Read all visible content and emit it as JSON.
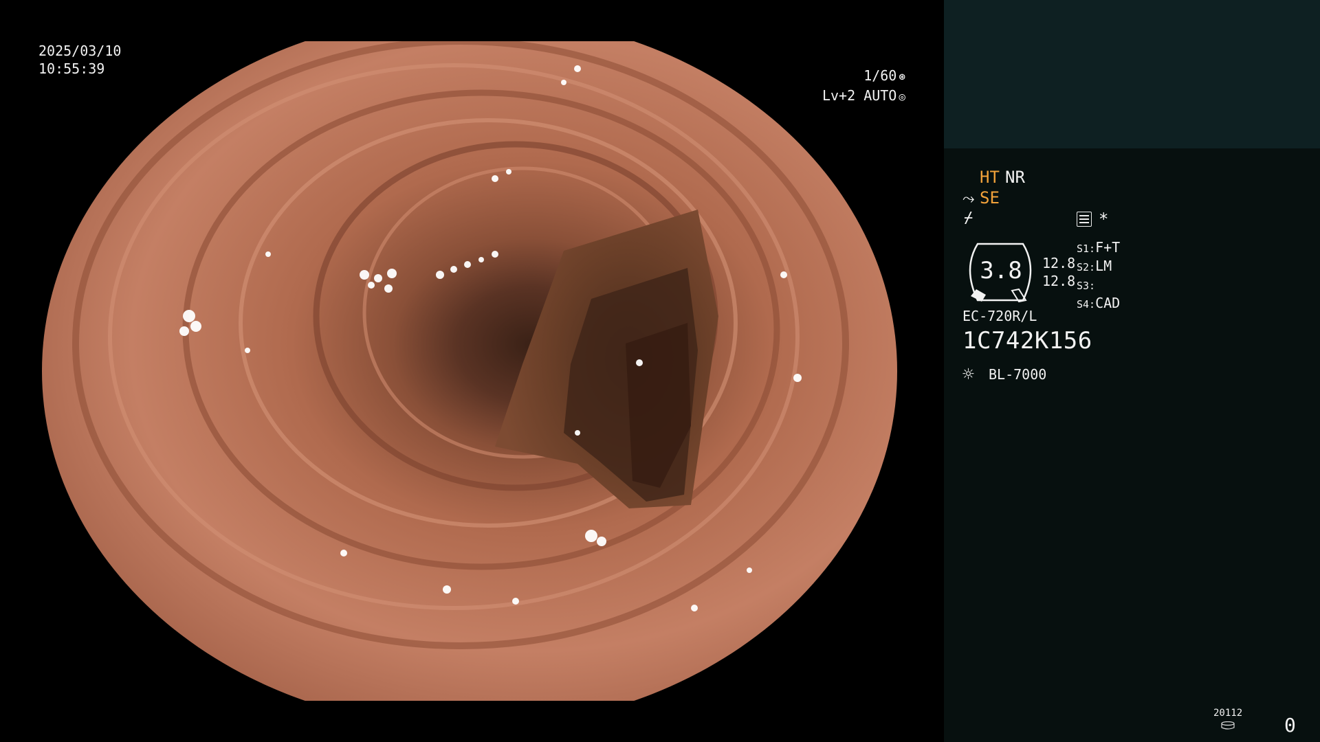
{
  "overlay": {
    "date": "2025/03/10",
    "time": "10:55:39",
    "shutter": "1/60",
    "shutter_icon": "aperture-icon",
    "level": "Lv+2",
    "mode": "AUTO",
    "mode_icon": "auto-iris-icon"
  },
  "settings": {
    "ht": "HT",
    "nr": "NR",
    "se": "SE",
    "se_icon": "scope-tip-icon",
    "freeze_icon": "freeze-icon",
    "menu_icon": "settings-list-icon",
    "star": "*"
  },
  "gauge": {
    "value": "3.8",
    "side_values": [
      "12.8",
      "12.8"
    ]
  },
  "scope_switches": [
    {
      "key": "S1:",
      "value": "F+T"
    },
    {
      "key": "S2:",
      "value": "LM"
    },
    {
      "key": "S3:",
      "value": ""
    },
    {
      "key": "S4:",
      "value": "CAD"
    }
  ],
  "device": {
    "model": "EC-720R/L",
    "serial": "1C742K156",
    "lamp_icon": "light-source-icon",
    "lamp": "BL-7000"
  },
  "recording": {
    "code": "20112",
    "icon": "storage-disk-icon",
    "count": "0"
  },
  "colors": {
    "right_panel": "#07100f",
    "right_header": "#0e2022",
    "highlight": "#f2a23a",
    "mucosa": "#b87458"
  }
}
